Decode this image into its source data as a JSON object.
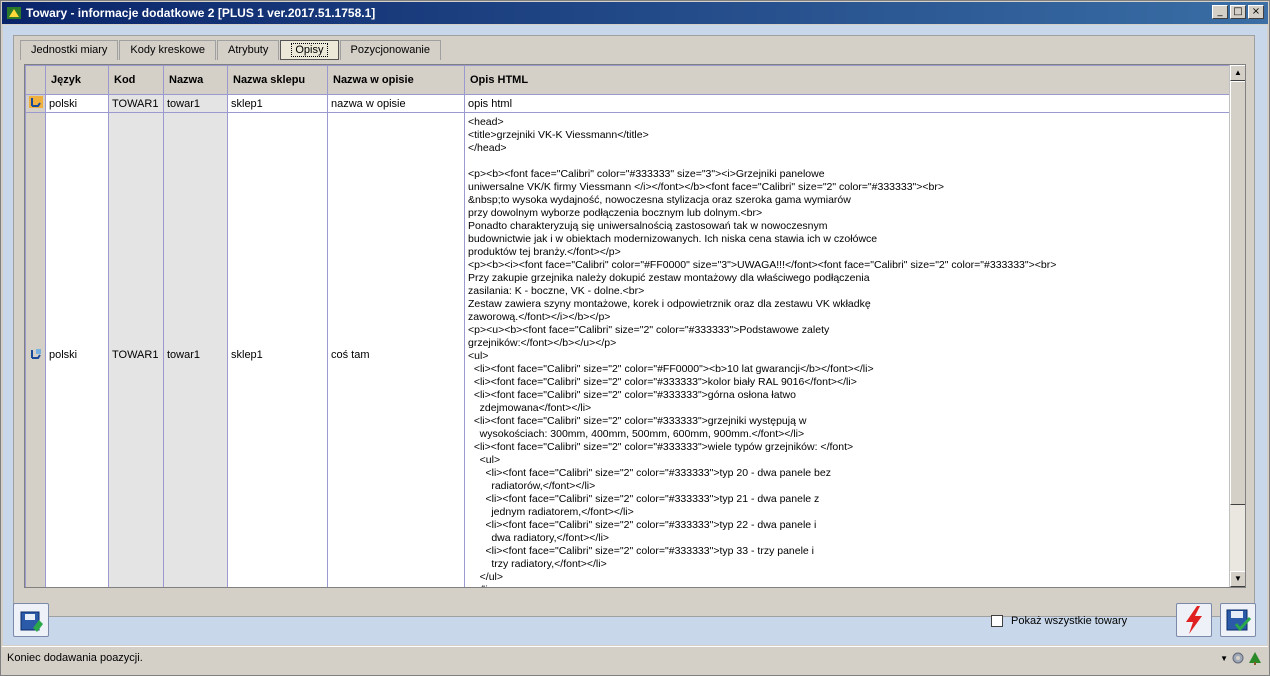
{
  "window": {
    "title": "Towary - informacje dodatkowe 2 [PLUS 1 ver.2017.51.1758.1]",
    "minimize": "_",
    "maximize": "□",
    "close": "×"
  },
  "tabs": [
    "Jednostki miary",
    "Kody kreskowe",
    "Atrybuty",
    "Opisy",
    "Pozycjonowanie"
  ],
  "active_tab": "Opisy",
  "table": {
    "headers": [
      "Język",
      "Kod",
      "Nazwa",
      "Nazwa sklepu",
      "Nazwa w opisie",
      "Opis HTML"
    ],
    "rows": [
      {
        "jezyk": "polski",
        "kod": "TOWAR1",
        "nazwa": "towar1",
        "nazwa_sklepu": "sklep1",
        "nazwa_w_opisie": "nazwa w opisie",
        "opis_html": "opis html"
      },
      {
        "jezyk": "polski",
        "kod": "TOWAR1",
        "nazwa": "towar1",
        "nazwa_sklepu": "sklep1",
        "nazwa_w_opisie": "coś tam",
        "opis_html": "<head>\n<title>grzejniki VK-K Viessmann</title>\n</head>\n\n<p><b><font face=\"Calibri\" color=\"#333333\" size=\"3\"><i>Grzejniki panelowe\nuniwersalne VK/K firmy Viessmann </i></font></b><font face=\"Calibri\" size=\"2\" color=\"#333333\"><br>\n&nbsp;to wysoka wydajność, nowoczesna stylizacja oraz szeroka gama wymiarów\nprzy dowolnym wyborze podłączenia bocznym lub dolnym.<br>\nPonadto charakteryzują się uniwersalnością zastosowań tak w nowoczesnym\nbudownictwie jak i w obiektach modernizowanych. Ich niska cena stawia ich w czołówce\nproduktów tej branży.</font></p>\n<p><b><i><font face=\"Calibri\" color=\"#FF0000\" size=\"3\">UWAGA!!!</font><font face=\"Calibri\" size=\"2\" color=\"#333333\"><br>\nPrzy zakupie grzejnika należy dokupić zestaw montażowy dla właściwego podłączenia\nzasilania: K - boczne, VK - dolne.<br>\nZestaw zawiera szyny montażowe, korek i odpowietrznik oraz dla zestawu VK wkładkę\nzaworową.</font></i></b></p>\n<p><u><b><font face=\"Calibri\" size=\"2\" color=\"#333333\">Podstawowe zalety\ngrzejników:</font></b></u></p>\n<ul>\n  <li><font face=\"Calibri\" size=\"2\" color=\"#FF0000\"><b>10 lat gwarancji</b></font></li>\n  <li><font face=\"Calibri\" size=\"2\" color=\"#333333\">kolor biały RAL 9016</font></li>\n  <li><font face=\"Calibri\" size=\"2\" color=\"#333333\">górna osłona łatwo\n    zdejmowana</font></li>\n  <li><font face=\"Calibri\" size=\"2\" color=\"#333333\">grzejniki występują w\n    wysokościach: 300mm, 400mm, 500mm, 600mm, 900mm.</font></li>\n  <li><font face=\"Calibri\" size=\"2\" color=\"#333333\">wiele typów grzejników: </font>\n    <ul>\n      <li><font face=\"Calibri\" size=\"2\" color=\"#333333\">typ 20 - dwa panele bez\n        radiatorów,</font></li>\n      <li><font face=\"Calibri\" size=\"2\" color=\"#333333\">typ 21 - dwa panele z\n        jednym radiatorem,</font></li>\n      <li><font face=\"Calibri\" size=\"2\" color=\"#333333\">typ 22 - dwa panele i\n        dwa radiatory,</font></li>\n      <li><font face=\"Calibri\" size=\"2\" color=\"#333333\">typ 33 - trzy panele i\n        trzy radiatory,</font></li>\n    </ul>\n  </li>"
      }
    ]
  },
  "checkbox": {
    "label": "Pokaż wszystkie towary",
    "checked": false
  },
  "status": {
    "text": "Koniec dodawania poazycji."
  },
  "colors": {
    "titlebar": "#0a246a",
    "accent_blue": "#c8d8ea",
    "red_icon": "#e02020"
  },
  "icons": [
    "app-icon",
    "add-record-icon",
    "row-pointer-icon",
    "row-edit-icon",
    "flash-icon",
    "save-icon",
    "gear-icon",
    "tree-icon"
  ]
}
